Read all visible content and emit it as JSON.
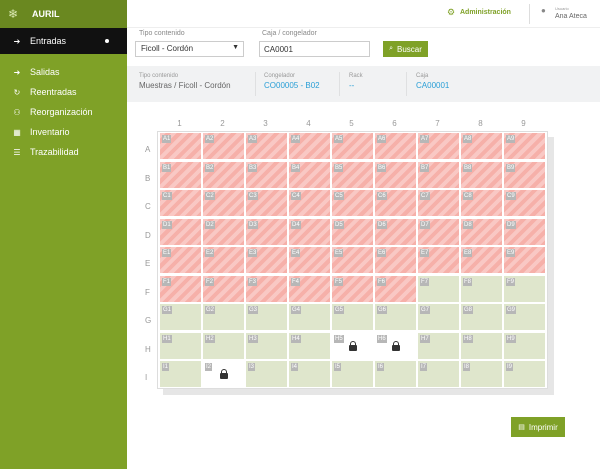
{
  "app": {
    "title": "AURIL",
    "logo_icon": "snowflake-icon"
  },
  "sidebar": {
    "items": [
      {
        "label": "Entradas",
        "icon": "sign-in-icon",
        "active": true
      },
      {
        "label": "Salidas",
        "icon": "sign-out-icon"
      },
      {
        "label": "Reentradas",
        "icon": "refresh-icon"
      },
      {
        "label": "Reorganización",
        "icon": "sitemap-icon"
      },
      {
        "label": "Inventario",
        "icon": "grid-icon"
      },
      {
        "label": "Trazabilidad",
        "icon": "list-icon"
      }
    ]
  },
  "topbar": {
    "admin_label": "Administración",
    "user_caption": "Usuario",
    "user_name": "Ana Ateca"
  },
  "filters": {
    "tipo_label": "Tipo contenido",
    "tipo_value": "Ficoll - Cordón",
    "caja_label": "Caja / congelador",
    "caja_value": "CA0001",
    "search_button": "Buscar"
  },
  "info": {
    "tipo_title": "Tipo contenido",
    "tipo_value": "Muestras / Ficoll - Cordón",
    "congelador_title": "Congelador",
    "congelador_value": "CO00005 - B02",
    "rack_title": "Rack",
    "rack_value": "--",
    "caja_title": "Caja",
    "caja_value": "CA00001"
  },
  "grid": {
    "columns": [
      "1",
      "2",
      "3",
      "4",
      "5",
      "6",
      "7",
      "8",
      "9"
    ],
    "rows": [
      "A",
      "B",
      "C",
      "D",
      "E",
      "F",
      "G",
      "H",
      "I"
    ],
    "status_rows": [
      "FFFFFFFFF",
      "FFFFFFFFF",
      "FFFFFFFFF",
      "FFFFFFFFF",
      "FFFFFFFFF",
      "FFFFFFEEE",
      "EEEEEEEEE",
      "EEEEBBEEE",
      "EBEEEEEEE"
    ],
    "colors": {
      "full": "#f6b0a9",
      "empty": "#dfe6cc",
      "blocked": "#ffffff"
    }
  },
  "print_button": "Imprimir"
}
